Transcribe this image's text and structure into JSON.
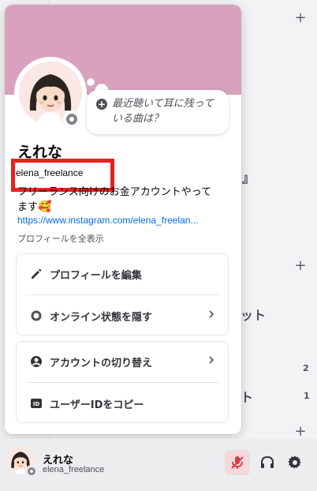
{
  "profile": {
    "display_name": "えれな",
    "username": "elena_freelance",
    "custom_status_prompt": "最近聴いて耳に残っている曲は？",
    "bio_line1": "フリーランス向けのお金アカウントやって",
    "bio_line2": "ます",
    "bio_emoji": "🥰",
    "link": "https://www.instagram.com/elena_freelan...",
    "view_full_profile": "プロフィールを全表示",
    "banner_color": "#d8a2be",
    "status": "offline"
  },
  "menu": {
    "edit_profile": "プロフィールを編集",
    "hide_online_status": "オンライン状態を隠す",
    "switch_account": "アカウントの切り替え",
    "copy_user_id": "ユーザーIDをコピー"
  },
  "user_panel": {
    "display_name": "えれな",
    "username": "elena_freelance"
  },
  "background": {
    "text_a": "』",
    "text_b": "ット",
    "text_c": "ト",
    "count_a": "2",
    "count_b": "1"
  },
  "colors": {
    "highlight": "#ea1f1f",
    "link": "#006ce7",
    "mute_bg": "#f3d8dc",
    "mute_icon": "#d83c3e"
  }
}
